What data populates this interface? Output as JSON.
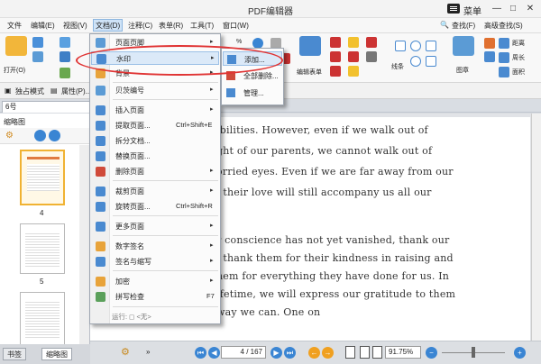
{
  "window": {
    "title": "PDF编辑器",
    "menu_label": "菜单",
    "minimize": "—",
    "maximize": "□",
    "close": "✕"
  },
  "menubar": {
    "items": [
      "文件",
      "编辑(E)",
      "视图(V)",
      "文档(D)",
      "注释(C)",
      "表单(R)",
      "工具(T)",
      "窗口(W)"
    ],
    "find": "查找(F)",
    "advanced_find": "高级查找(S)"
  },
  "ribbon": {
    "open_label": "打开(O)",
    "zoom_value": "%",
    "edit_form_label": "编辑表单",
    "lines_label": "线条",
    "stamp_label": "图章",
    "distance_label": "距离",
    "perimeter_label": "周长",
    "area_label": "面积"
  },
  "subbar": {
    "exclusive_mode": "独占模式",
    "properties": "属性(P)..."
  },
  "tab": {
    "label": "6号",
    "close": "✕"
  },
  "left_panel": {
    "title": "缩略图",
    "thumb_labels": [
      "4",
      "5"
    ],
    "bottom_tabs": [
      "书签",
      "缩略图"
    ]
  },
  "document": {
    "lines": [
      "ibilities. However, even if we walk out of",
      "ght of our parents, we cannot walk out of",
      "orried eyes. Even if we are far away from our",
      ", their love will still accompany us all our",
      "",
      "r conscience has not yet vanished, thank our",
      ", thank them for their kindness in raising and",
      "hem for everything they have done for us. In",
      "ifetime, we will express our gratitude to them",
      "way we can. One on"
    ]
  },
  "statusbar": {
    "page_value": "4",
    "page_total": "/ 167",
    "zoom_value": "91.75%"
  },
  "doc_menu": {
    "items": [
      {
        "label": "页面页脚",
        "shortcut": "",
        "arrow": "▸"
      },
      {
        "label": "水印",
        "shortcut": "",
        "arrow": "▸"
      },
      {
        "label": "背景",
        "shortcut": "",
        "arrow": "▸"
      },
      {
        "label": "贝茨编号",
        "shortcut": "",
        "arrow": "▸"
      },
      {
        "label": "插入页面",
        "shortcut": "",
        "arrow": "▸"
      },
      {
        "label": "提取页面...",
        "shortcut": "Ctrl+Shift+E",
        "arrow": ""
      },
      {
        "label": "拆分文档...",
        "shortcut": "",
        "arrow": ""
      },
      {
        "label": "替换页面...",
        "shortcut": "",
        "arrow": ""
      },
      {
        "label": "删除页面",
        "shortcut": "",
        "arrow": "▸"
      },
      {
        "label": "裁剪页面",
        "shortcut": "",
        "arrow": "▸"
      },
      {
        "label": "旋转页面...",
        "shortcut": "Ctrl+Shift+R",
        "arrow": ""
      },
      {
        "label": "更多页面",
        "shortcut": "",
        "arrow": "▸"
      },
      {
        "label": "数字签名",
        "shortcut": "",
        "arrow": "▸"
      },
      {
        "label": "签名与缩写",
        "shortcut": "",
        "arrow": "▸"
      },
      {
        "label": "加密",
        "shortcut": "",
        "arrow": "▸"
      },
      {
        "label": "拼写检查",
        "shortcut": "F7",
        "arrow": ""
      }
    ],
    "footer": "运行: ◻ <无>"
  },
  "watermark_submenu": {
    "items": [
      "添加...",
      "全部删除...",
      "管理..."
    ]
  },
  "colors": {
    "accent": "#3a85d3",
    "highlight": "#dbe9f8",
    "annotation": "#e03434"
  }
}
